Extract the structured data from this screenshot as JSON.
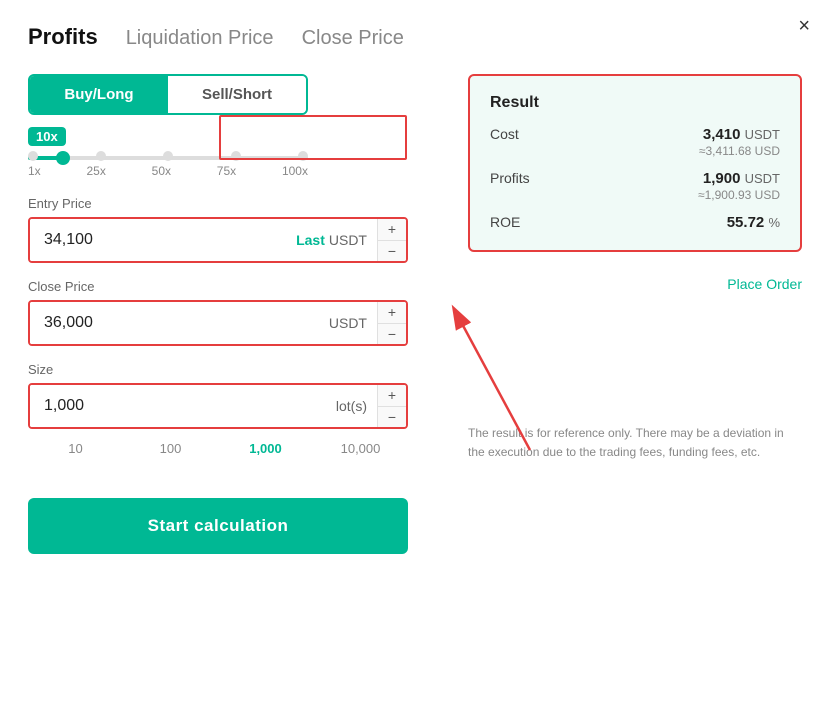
{
  "modal": {
    "close_label": "×"
  },
  "tabs": {
    "active": "Profits",
    "items": [
      {
        "label": "Profits",
        "active": true
      },
      {
        "label": "Liquidation Price",
        "active": false
      },
      {
        "label": "Close Price",
        "active": false
      }
    ]
  },
  "toggle": {
    "buy_long": "Buy/Long",
    "sell_short": "Sell/Short"
  },
  "leverage": {
    "value": "10x",
    "marks": [
      "1x",
      "25x",
      "50x",
      "75x",
      "100x"
    ]
  },
  "entry_price": {
    "label": "Entry Price",
    "value": "34,100",
    "last_label": "Last",
    "unit": "USDT",
    "plus": "+",
    "minus": "−"
  },
  "close_price": {
    "label": "Close Price",
    "value": "36,000",
    "unit": "USDT",
    "plus": "+",
    "minus": "−"
  },
  "size": {
    "label": "Size",
    "value": "1,000",
    "unit": "lot(s)",
    "plus": "+",
    "minus": "−",
    "presets": [
      "10",
      "100",
      "1,000",
      "10,000"
    ]
  },
  "calc_button": "Start calculation",
  "result": {
    "title": "Result",
    "cost": {
      "key": "Cost",
      "value": "3,410",
      "unit": "USDT",
      "sub": "≈3,411.68 USD"
    },
    "profits": {
      "key": "Profits",
      "value": "1,900",
      "unit": "USDT",
      "sub": "≈1,900.93 USD"
    },
    "roe": {
      "key": "ROE",
      "value": "55.72",
      "unit": "%"
    },
    "place_order": "Place Order"
  },
  "disclaimer": "The result is for reference only. There may be a deviation in the execution due to the trading fees, funding fees, etc."
}
